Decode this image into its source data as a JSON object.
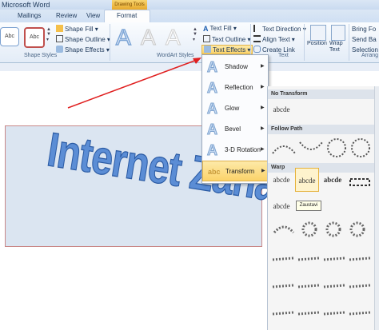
{
  "window": {
    "title": "Microsoft Word",
    "context_tab": "Drawing Tools"
  },
  "tabs": [
    "Mailings",
    "Review",
    "View",
    "Format"
  ],
  "ribbon": {
    "shape_styles": {
      "style_previews": [
        "Abc",
        "Abc"
      ],
      "commands": [
        "Shape Fill",
        "Shape Outline",
        "Shape Effects"
      ],
      "group_label": "Shape Styles"
    },
    "wordart_styles": {
      "letters": [
        "A",
        "A",
        "A",
        "A"
      ],
      "commands": [
        "Text Fill",
        "Text Outline",
        "Text Effects"
      ],
      "group_label": "WordArt Styles"
    },
    "text": {
      "commands": [
        "Text Direction",
        "Align Text",
        "Create Link"
      ],
      "group_label": "Text"
    },
    "arrange": {
      "commands": [
        "Position",
        "Wrap Text"
      ],
      "side_commands": [
        "Bring Fo",
        "Send Ba",
        "Selection"
      ],
      "group_label": "Arrang"
    }
  },
  "document": {
    "wordart_text": "Internet Zanatlija"
  },
  "effects_menu": {
    "items": [
      {
        "label": "Shadow",
        "glyph": "A"
      },
      {
        "label": "Reflection",
        "glyph": "A"
      },
      {
        "label": "Glow",
        "glyph": "A"
      },
      {
        "label": "Bevel",
        "glyph": "A"
      },
      {
        "label": "3-D Rotation",
        "glyph": "A"
      },
      {
        "label": "Transform",
        "glyph": "abc"
      }
    ]
  },
  "transform_gallery": {
    "headers": [
      "No Transform",
      "Follow Path",
      "Warp"
    ],
    "no_transform_sample": "abcde",
    "warp_samples": [
      "abcde",
      "abcde",
      "abcde",
      "abcde"
    ],
    "tooltip": "Zaustavi"
  },
  "colors": {
    "accent_highlight": "#fbd36a",
    "wordart_fill": "#5b8dd5",
    "arrow": "#e02020"
  }
}
